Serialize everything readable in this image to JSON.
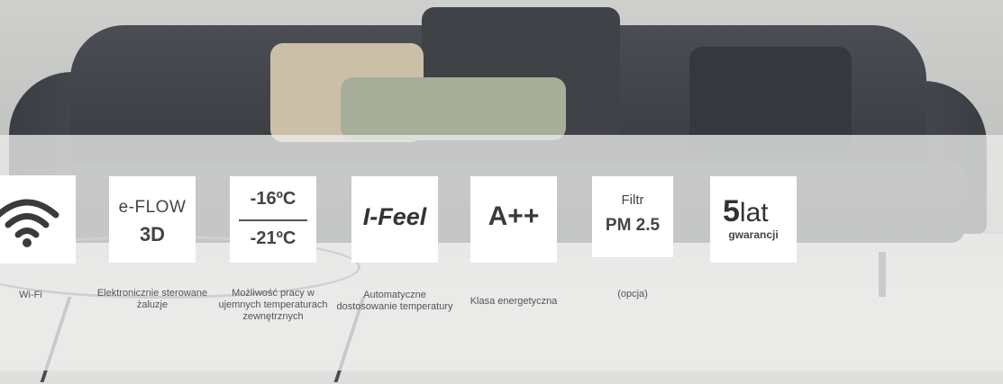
{
  "features": [
    {
      "label": "Wi-Fi",
      "icon": "wifi-icon"
    },
    {
      "card": {
        "line1": "e-FLOW",
        "line2": "3D"
      },
      "label": "Elektronicznie sterowane żaluzje"
    },
    {
      "card": {
        "line1": "-16ºC",
        "line2": "-21ºC"
      },
      "label": "Możliwość pracy w ujemnych temperaturach zewnętrznych"
    },
    {
      "card": {
        "line1": "I-Feel"
      },
      "label": "Automatyczne dostosowanie temperatury"
    },
    {
      "card": {
        "line1": "A++"
      },
      "label": "Klasa energetyczna"
    },
    {
      "card": {
        "line1": "Filtr",
        "line2": "PM 2.5"
      },
      "label": "(opcja)"
    },
    {
      "card": {
        "num": "5",
        "unit": "lat",
        "sub": "gwarancji"
      }
    }
  ]
}
